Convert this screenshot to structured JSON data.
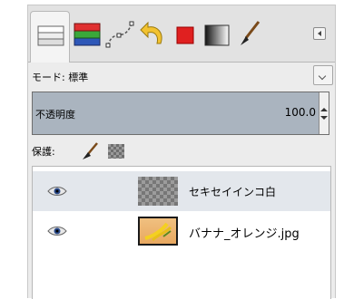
{
  "tabs": [
    {
      "icon": "layers-icon",
      "active": true
    },
    {
      "icon": "channels-icon"
    },
    {
      "icon": "paths-icon"
    },
    {
      "icon": "undo-history-icon"
    },
    {
      "icon": "foreground-color-icon",
      "color": "#e02020"
    },
    {
      "icon": "gradient-icon"
    },
    {
      "icon": "brush-icon"
    }
  ],
  "panel_menu_icon": "panel-menu-icon",
  "mode": {
    "label": "モード: 標準"
  },
  "opacity": {
    "label": "不透明度",
    "value": "100.0"
  },
  "protect": {
    "label": "保護:",
    "icons": [
      "lock-pixels-icon",
      "lock-alpha-icon"
    ]
  },
  "layers": [
    {
      "name": "セキセイインコ白",
      "visible": true,
      "thumbnail": "transparent",
      "selected": true
    },
    {
      "name": "バナナ_オレンジ.jpg",
      "visible": true,
      "thumbnail": "image",
      "selected": false
    }
  ]
}
